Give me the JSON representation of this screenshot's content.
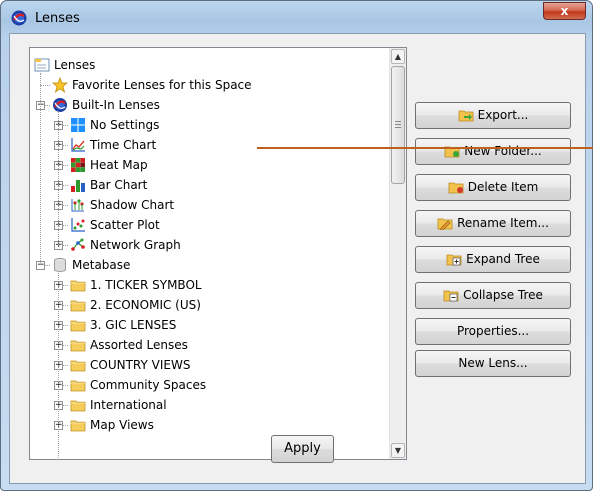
{
  "window": {
    "title": "Lenses",
    "close_glyph": "x"
  },
  "tree": {
    "nodes": [
      {
        "label": "Lenses",
        "icon": "root-folder-icon"
      },
      {
        "label": "Favorite Lenses for this Space",
        "icon": "star-icon"
      },
      {
        "label": "Built-In Lenses",
        "icon": "builtin-lenses-icon"
      },
      {
        "label": "No Settings",
        "icon": "no-settings-icon"
      },
      {
        "label": "Time Chart",
        "icon": "time-chart-icon"
      },
      {
        "label": "Heat Map",
        "icon": "heat-map-icon"
      },
      {
        "label": "Bar Chart",
        "icon": "bar-chart-icon"
      },
      {
        "label": "Shadow Chart",
        "icon": "shadow-chart-icon"
      },
      {
        "label": "Scatter Plot",
        "icon": "scatter-plot-icon"
      },
      {
        "label": "Network Graph",
        "icon": "network-graph-icon"
      },
      {
        "label": "Metabase",
        "icon": "database-icon"
      },
      {
        "label": "1. TICKER SYMBOL",
        "icon": "folder-icon"
      },
      {
        "label": "2. ECONOMIC (US)",
        "icon": "folder-icon"
      },
      {
        "label": "3. GIC LENSES",
        "icon": "folder-icon"
      },
      {
        "label": "Assorted Lenses",
        "icon": "folder-icon"
      },
      {
        "label": "COUNTRY VIEWS",
        "icon": "folder-icon"
      },
      {
        "label": "Community Spaces",
        "icon": "folder-icon"
      },
      {
        "label": "International",
        "icon": "folder-icon"
      },
      {
        "label": "Map Views",
        "icon": "folder-icon"
      }
    ]
  },
  "buttons": {
    "export": "Export...",
    "new_folder": "New Folder...",
    "delete_item": "Delete Item",
    "rename_item": "Rename Item...",
    "expand_tree": "Expand Tree",
    "collapse_tree": "Collapse Tree",
    "properties": "Properties...",
    "new_lens": "New Lens...",
    "apply": "Apply"
  },
  "colors": {
    "accent_line": "#c0601d",
    "close_button": "#c2391c"
  }
}
